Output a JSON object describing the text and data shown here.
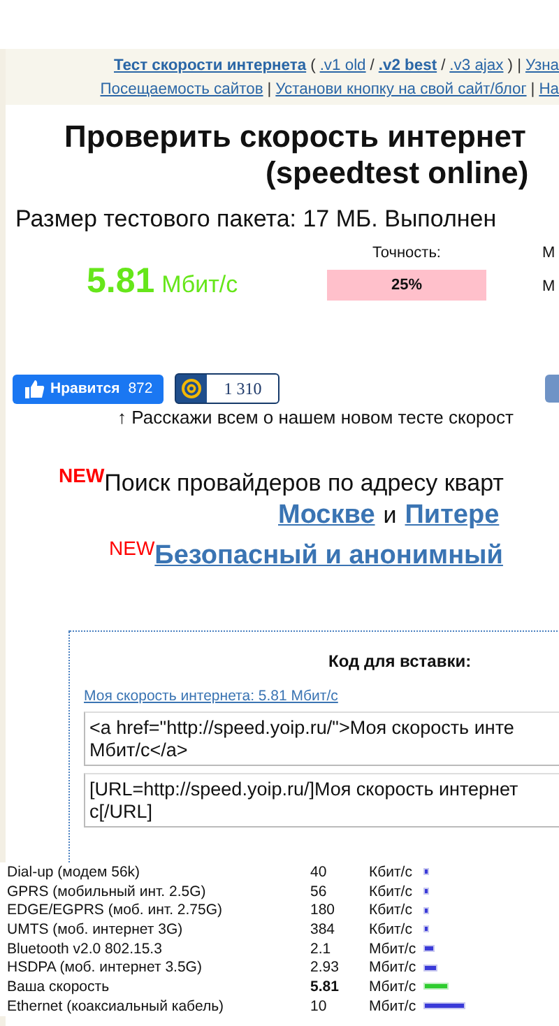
{
  "nav": {
    "line1": [
      {
        "text": "Тест скорости интернета",
        "kind": "link",
        "bold": true
      },
      {
        "text": "(",
        "kind": "text"
      },
      {
        "text": ".v1 old",
        "kind": "link",
        "bold": false
      },
      {
        "text": "/",
        "kind": "text"
      },
      {
        "text": ".v2 best",
        "kind": "link",
        "bold": true
      },
      {
        "text": "/",
        "kind": "text"
      },
      {
        "text": ".v3 ajax",
        "kind": "link",
        "bold": false
      },
      {
        "text": ") |",
        "kind": "text"
      },
      {
        "text": "Узна",
        "kind": "link",
        "bold": false
      }
    ],
    "line2": [
      {
        "text": "Посещаемость сайтов",
        "kind": "link",
        "bold": false
      },
      {
        "text": "|",
        "kind": "text"
      },
      {
        "text": "Установи кнопку на свой сайт/блог",
        "kind": "link",
        "bold": false
      },
      {
        "text": "|",
        "kind": "text"
      },
      {
        "text": "На",
        "kind": "link",
        "bold": false
      }
    ]
  },
  "title": [
    "Проверить скорость интернет",
    "(speedtest online)"
  ],
  "packet_info": "Размер тестового пакета: 17 МБ. Выполнен",
  "result": {
    "value": "5.81",
    "unit": "Мбит/с"
  },
  "accuracy": {
    "label": "Точность:",
    "value": "25%"
  },
  "column_3": {
    "label": "М",
    "value": "М"
  },
  "social": {
    "like": {
      "label": "Нравится",
      "count": "872"
    },
    "mail": {
      "count": "1 310"
    }
  },
  "share_text": "↑ Расскажи всем о нашем новом тесте скорост",
  "promo": {
    "badge": "NEW",
    "text": "Поиск провайдеров по адресу кварт",
    "links": [
      {
        "text": "Москве",
        "kind": "link"
      },
      {
        "text": "и",
        "kind": "text"
      },
      {
        "text": "Питере",
        "kind": "link"
      }
    ]
  },
  "promo2": {
    "badge": "NEW",
    "link": "Безопасный и анонимный"
  },
  "embed": {
    "title": "Код для вставки:",
    "preview_link": "Моя скорость интернета: 5.81 Мбит/с",
    "codes": [
      [
        "<a href=\"http://speed.yoip.ru/\">Моя скорость инте",
        "Мбит/с</a>"
      ],
      [
        "[URL=http://speed.yoip.ru/]Моя скорость интернет",
        "c[/URL]"
      ]
    ]
  },
  "comparison": [
    {
      "name": "Dial-up (модем 56k)",
      "value": "40",
      "unit": "Кбит/с",
      "kind": "kbit",
      "yours": false
    },
    {
      "name": "GPRS (мобильный инт. 2.5G)",
      "value": "56",
      "unit": "Кбит/с",
      "kind": "kbit",
      "yours": false
    },
    {
      "name": "EDGE/EGPRS (моб. инт. 2.75G)",
      "value": "180",
      "unit": "Кбит/с",
      "kind": "kbit",
      "yours": false
    },
    {
      "name": "UMTS (моб. интернет 3G)",
      "value": "384",
      "unit": "Кбит/с",
      "kind": "kbit",
      "yours": false
    },
    {
      "name": "Bluetooth v2.0 802.15.3",
      "value": "2.1",
      "unit": "Мбит/с",
      "kind": "mbit",
      "yours": false
    },
    {
      "name": "HSDPA (моб. интернет 3.5G)",
      "value": "2.93",
      "unit": "Мбит/с",
      "kind": "mbit",
      "yours": false
    },
    {
      "name": "Ваша скорость",
      "value": "5.81",
      "unit": "Мбит/с",
      "kind": "mbit",
      "yours": true
    },
    {
      "name": "Ethernet (коаксиальный кабель)",
      "value": "10",
      "unit": "Мбит/с",
      "kind": "mbit",
      "yours": false
    }
  ]
}
